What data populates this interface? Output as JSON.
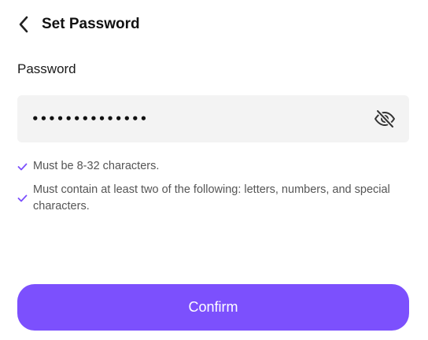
{
  "header": {
    "title": "Set Password",
    "back_icon": "chevron-left-icon"
  },
  "password_field": {
    "label": "Password",
    "value": "••••••••••••••",
    "visibility_icon": "eye-off-icon"
  },
  "rules": [
    {
      "text": "Must be 8-32 characters.",
      "icon": "check-icon",
      "satisfied": true
    },
    {
      "text": "Must contain at least two of the following: letters, numbers, and special characters.",
      "icon": "check-icon",
      "satisfied": true
    }
  ],
  "confirm_button": {
    "label": "Confirm"
  },
  "colors": {
    "accent": "#7c50fd",
    "input_background": "#f3f3f3",
    "check": "#7c50fd"
  }
}
